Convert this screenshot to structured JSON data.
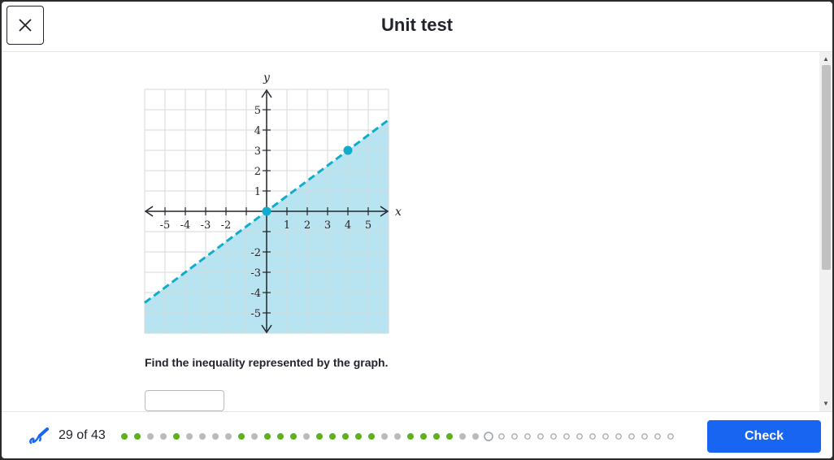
{
  "header": {
    "title": "Unit test",
    "close_icon": "close-icon"
  },
  "question": {
    "prompt": "Find the inequality represented by the graph.",
    "answer_value": ""
  },
  "footer": {
    "progress_text": "29 of 43",
    "check_label": "Check",
    "accent_color": "#1865f2",
    "dots": [
      "correct",
      "correct",
      "skipped",
      "skipped",
      "correct",
      "skipped",
      "skipped",
      "skipped",
      "skipped",
      "correct",
      "skipped",
      "correct",
      "correct",
      "correct",
      "skipped",
      "correct",
      "correct",
      "correct",
      "correct",
      "correct",
      "skipped",
      "skipped",
      "correct",
      "correct",
      "correct",
      "correct",
      "skipped",
      "skipped",
      "current",
      "empty",
      "empty",
      "empty",
      "empty",
      "empty",
      "empty",
      "empty",
      "empty",
      "empty",
      "empty",
      "empty",
      "empty",
      "empty",
      "empty"
    ],
    "dot_colors": {
      "correct": "#5cb21d",
      "skipped": "#b8babe",
      "current": "#9aa0a8",
      "empty": "#9aa0a8"
    }
  },
  "chart_data": {
    "type": "line",
    "title": "",
    "xlabel": "x",
    "ylabel": "y",
    "xlim": [
      -6,
      6
    ],
    "ylim": [
      -6,
      6
    ],
    "grid": true,
    "x_tick_labels": [
      "-5",
      "-4",
      "-3",
      "-2",
      "1",
      "2",
      "3",
      "4",
      "5"
    ],
    "x_tick_values": [
      -5,
      -4,
      -3,
      -2,
      1,
      2,
      3,
      4,
      5
    ],
    "y_tick_labels": [
      "5",
      "4",
      "3",
      "2",
      "1",
      "-2",
      "-3",
      "-4",
      "-5"
    ],
    "y_tick_values": [
      5,
      4,
      3,
      2,
      1,
      -2,
      -3,
      -4,
      -5
    ],
    "series": [
      {
        "style": "dashed",
        "points": [
          {
            "x": 0,
            "y": 0
          },
          {
            "x": 4,
            "y": 3
          }
        ],
        "color": "#11accd"
      }
    ],
    "shaded_region": "below",
    "shade_color": "#b7e4f0"
  }
}
